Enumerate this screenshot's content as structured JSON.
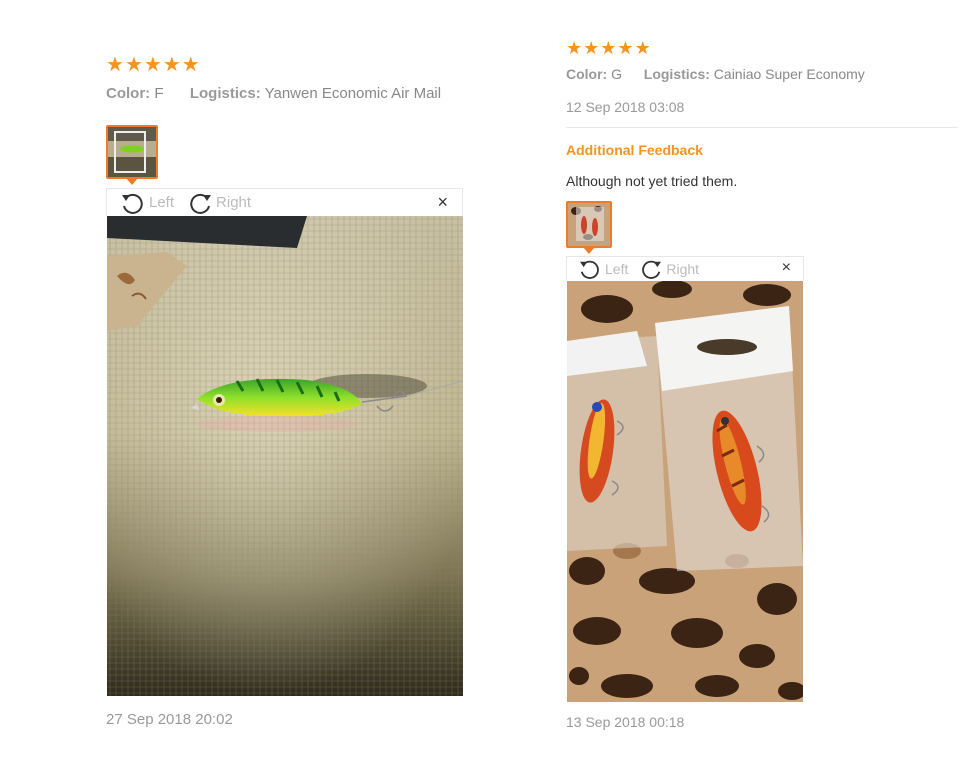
{
  "colors": {
    "accent": "#f7931e",
    "thumb_border": "#ec7b2a",
    "muted": "#999999"
  },
  "reviews": [
    {
      "rating": 5,
      "color_label": "Color:",
      "color_value": "F",
      "logistics_label": "Logistics:",
      "logistics_value": "Yanwen Economic Air Mail",
      "toolbar": {
        "left": "Left",
        "right": "Right",
        "close": "×"
      },
      "date": "27 Sep 2018 20:02"
    },
    {
      "rating": 5,
      "color_label": "Color:",
      "color_value": "G",
      "logistics_label": "Logistics:",
      "logistics_value": "Cainiao Super Economy",
      "date_top": "12 Sep 2018 03:08",
      "additional_feedback_label": "Additional Feedback",
      "additional_feedback_text": "Although not yet tried them.",
      "toolbar": {
        "left": "Left",
        "right": "Right",
        "close": "×"
      },
      "date": "13 Sep 2018 00:18"
    }
  ]
}
